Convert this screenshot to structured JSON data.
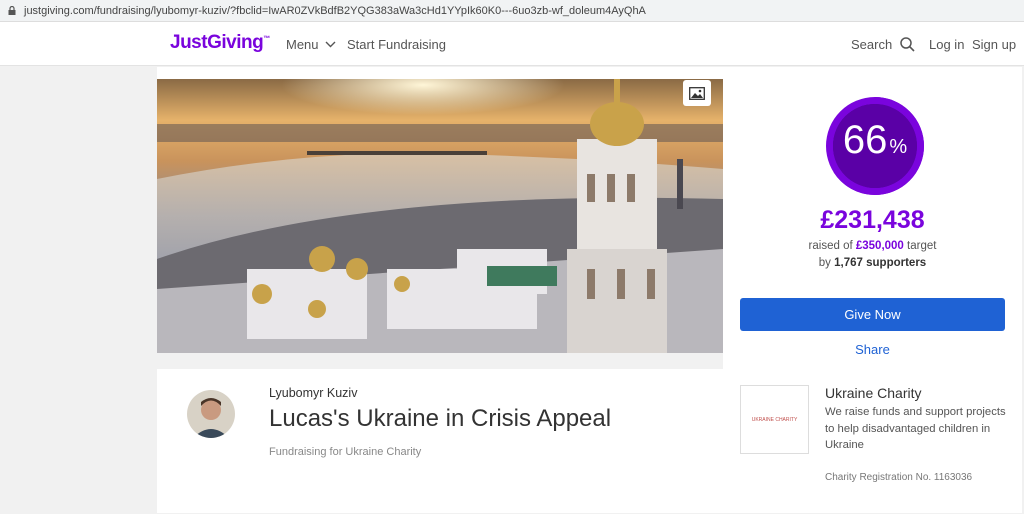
{
  "browser": {
    "url": "justgiving.com/fundraising/lyubomyr-kuziv/?fbclid=IwAR0ZVkBdfB2YQG383aWa3cHd1YYpIk60K0---6uo3zb-wf_doleum4AyQhA"
  },
  "header": {
    "logo": "JustGiving",
    "logo_mark": "™",
    "menu_label": "Menu",
    "start_label": "Start Fundraising",
    "search_label": "Search",
    "login_label": "Log in",
    "signup_label": "Sign up",
    "brand_color": "#7a04dd"
  },
  "progress": {
    "percent_text": "66",
    "percent_symbol": "%",
    "percent_value": 0.66,
    "raised": "£231,438",
    "target_prefix": "raised of",
    "target_amount": "£350,000",
    "target_suffix": "target",
    "supporters_prefix": "by",
    "supporters_count": "1,767",
    "supporters_suffix": "supporters"
  },
  "actions": {
    "give_label": "Give Now",
    "share_label": "Share",
    "give_color": "#1f62d4"
  },
  "page": {
    "owner": "Lyubomyr Kuziv",
    "title": "Lucas's Ukraine in Crisis Appeal",
    "fundraising_for": "Fundraising for Ukraine Charity"
  },
  "charity": {
    "logo_text": "UKRAINE CHARITY",
    "name": "Ukraine Charity",
    "description": "We raise funds and support projects to help disadvantaged children in Ukraine",
    "registration": "Charity Registration No. 1163036"
  },
  "icons": {
    "image": "image-icon",
    "search": "search-icon",
    "menu": "chevron-down-icon",
    "lock": "lock-icon"
  }
}
